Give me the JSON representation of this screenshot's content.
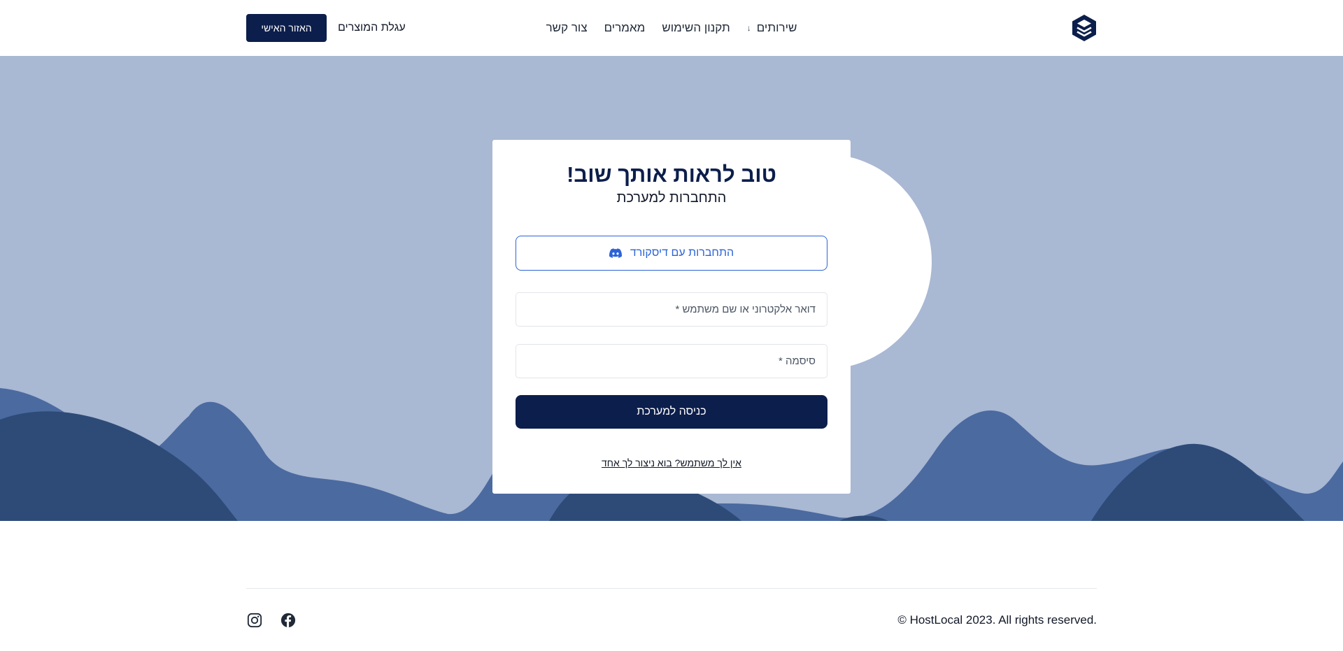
{
  "header": {
    "logo_icon": "stacked-layers-logo-icon",
    "nav": [
      {
        "label": "שירותים",
        "has_dropdown": true
      },
      {
        "label": "תקנון השימוש"
      },
      {
        "label": "מאמרים"
      },
      {
        "label": "צור קשר"
      }
    ],
    "cart_label": "עגלת המוצרים",
    "account_button_label": "האזור האישי"
  },
  "login": {
    "title": "טוב לראות אותך שוב!",
    "subtitle": "התחברות למערכת",
    "discord_button_label": "התחברות עם דיסקורד",
    "email_placeholder": "דואר אלקטרוני או שם משתמש *",
    "email_value": "",
    "password_placeholder": "סיסמה *",
    "password_value": "",
    "submit_label": "כניסה למערכת",
    "signup_link": "אין לך משתמש? בוא ניצור לך אחד"
  },
  "footer": {
    "copyright": "© HostLocal 2023. All rights reserved.",
    "social": [
      "instagram-icon",
      "facebook-icon"
    ]
  },
  "colors": {
    "primary": "#0c1e4b",
    "accent": "#2c63d8",
    "hero_background": "#a9b8d3",
    "wave_mid": "#4b6aa0",
    "wave_dark": "#2e4b78"
  }
}
